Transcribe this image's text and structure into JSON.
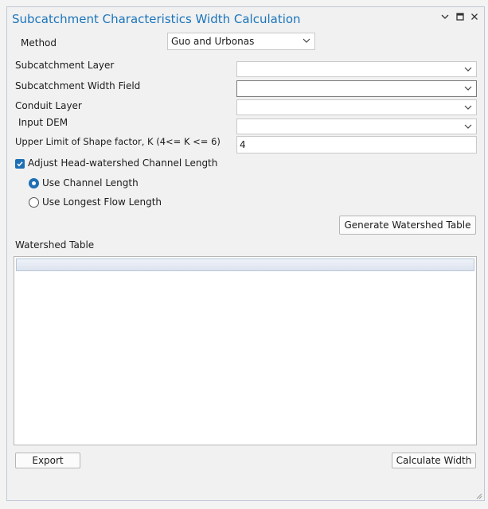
{
  "window": {
    "title": "Subcatchment Characteristics Width Calculation",
    "controls": [
      "chevron-down-icon",
      "maximize-icon",
      "close-icon"
    ]
  },
  "method": {
    "label": "Method",
    "value": "Guo and Urbonas"
  },
  "fields": {
    "subcatchment_layer": {
      "label": "Subcatchment Layer",
      "value": ""
    },
    "width_field": {
      "label": "Subcatchment Width Field",
      "value": ""
    },
    "conduit_layer": {
      "label": "Conduit Layer",
      "value": ""
    },
    "input_dem": {
      "label": "Input DEM",
      "value": ""
    },
    "shape_factor": {
      "label": "Upper Limit of Shape factor, K (4<= K <= 6)",
      "value": "4"
    }
  },
  "adjust": {
    "label": "Adjust Head-watershed Channel Length",
    "checked": true,
    "options": [
      {
        "label": "Use Channel Length",
        "selected": true
      },
      {
        "label": "Use Longest Flow Length",
        "selected": false
      }
    ]
  },
  "buttons": {
    "generate": "Generate Watershed Table",
    "export": "Export",
    "calculate": "Calculate Width"
  },
  "table": {
    "label": "Watershed Table",
    "rows": []
  },
  "colors": {
    "title": "#1b75bb",
    "accent": "#1f6fb5",
    "background": "#f1f1f1"
  }
}
